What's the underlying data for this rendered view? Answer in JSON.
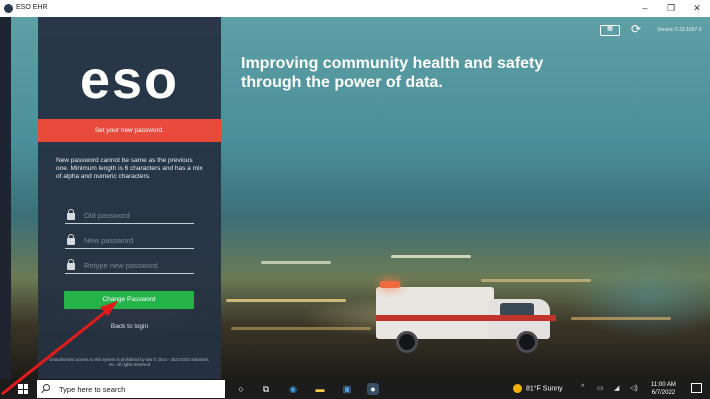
{
  "window": {
    "title": "ESO EHR",
    "minimize": "–",
    "maximize": "❐",
    "close": "✕"
  },
  "hero": {
    "headline": "Improving community health and safety through the power of data.",
    "version": "Version 5.33.1697.0"
  },
  "login_panel": {
    "logo_text": "eso",
    "banner": "Set your new password.",
    "instructions": "New password cannot be same as the previous one. Minimum length is 6 characters and has a mix of alpha and numeric characters.",
    "old_password_placeholder": "Old password",
    "new_password_placeholder": "New password",
    "retype_password_placeholder": "Retype new password",
    "change_button": "Change Password",
    "back_link": "Back to login",
    "footnote": "Unauthorized access to this system is prohibited by law © 2014 - 2022 ESO Solutions, Inc. All rights reserved"
  },
  "taskbar": {
    "search_placeholder": "Type here to search",
    "weather": "81°F  Sunny",
    "time": "11:00 AM",
    "date": "6/7/2022"
  },
  "colors": {
    "panel": "#263242",
    "banner": "#e84b3c",
    "button": "#25b34a",
    "annotation_arrow": "#e11b1b"
  }
}
